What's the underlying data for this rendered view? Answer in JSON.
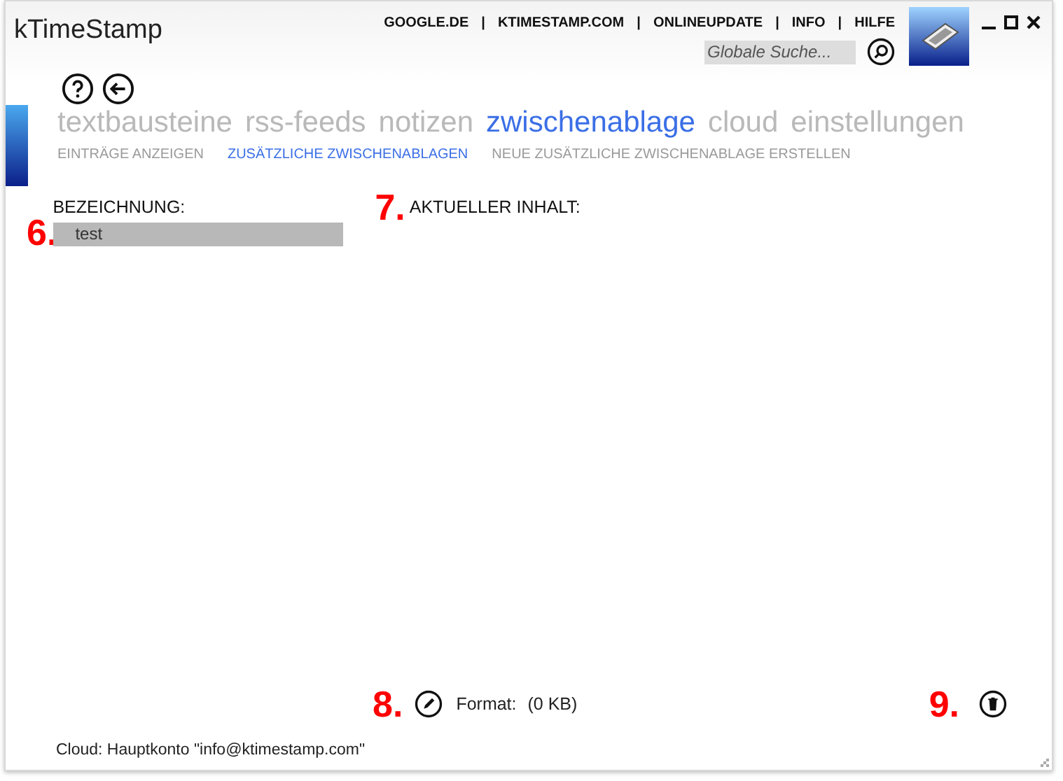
{
  "window": {
    "title": "kTimeStamp"
  },
  "top_links": [
    "GOOGLE.DE",
    "KTIMESTAMP.COM",
    "ONLINEUPDATE",
    "INFO",
    "HILFE"
  ],
  "link_separator": "|",
  "search": {
    "placeholder": "Globale Suche..."
  },
  "nav_tabs": [
    {
      "label": "textbausteine",
      "selected": false
    },
    {
      "label": "rss-feeds",
      "selected": false
    },
    {
      "label": "notizen",
      "selected": false
    },
    {
      "label": "zwischenablage",
      "selected": true
    },
    {
      "label": "cloud",
      "selected": false
    },
    {
      "label": "einstellungen",
      "selected": false
    }
  ],
  "sub_tabs": [
    {
      "label": "EINTRÄGE ANZEIGEN",
      "selected": false
    },
    {
      "label": "ZUSÄTZLICHE ZWISCHENABLAGEN",
      "selected": true
    },
    {
      "label": "NEUE ZUSÄTZLICHE ZWISCHENABLAGE ERSTELLEN",
      "selected": false
    }
  ],
  "list": {
    "callout": "6.",
    "heading": "BEZEICHNUNG:",
    "items": [
      {
        "label": "test",
        "selected": true
      }
    ]
  },
  "content": {
    "callout": "7.",
    "heading": "AKTUELLER INHALT:"
  },
  "format": {
    "callout": "8.",
    "label": "Format:",
    "size": "(0 KB)"
  },
  "delete": {
    "callout": "9."
  },
  "status_bar": "Cloud: Hauptkonto \"info@ktimestamp.com\""
}
